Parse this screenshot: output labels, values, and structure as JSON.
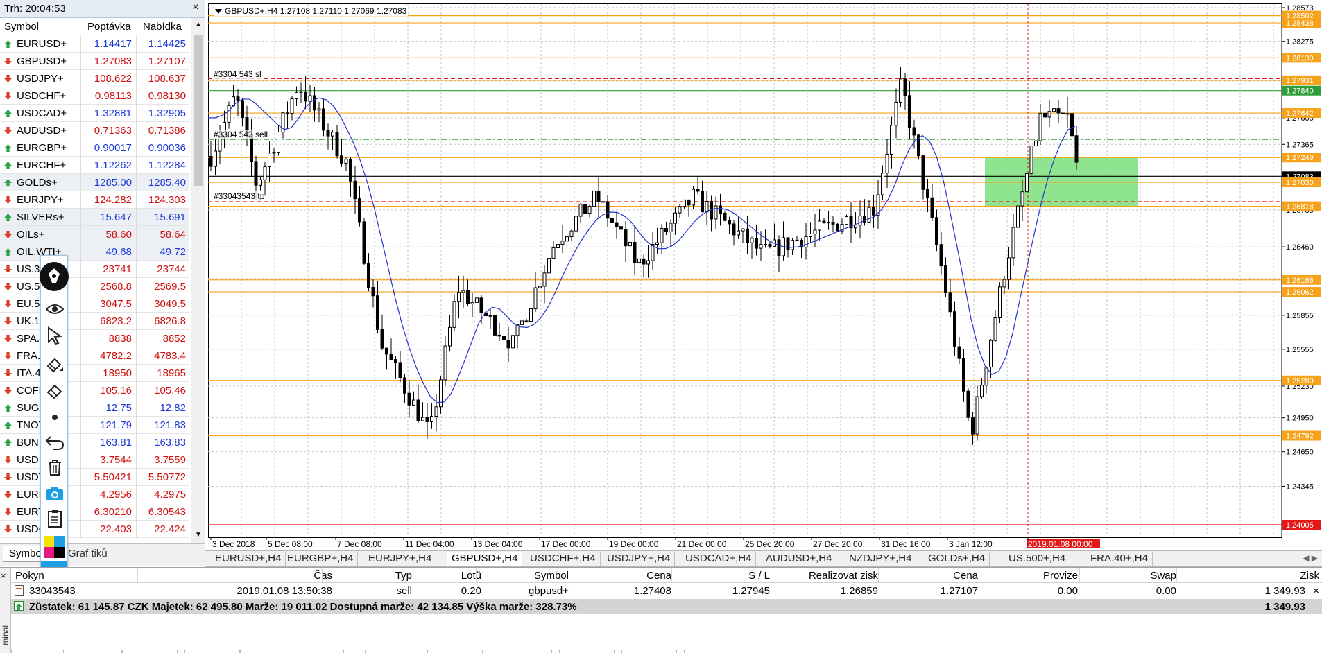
{
  "market_watch": {
    "title": "Trh: 20:04:53",
    "columns": {
      "symbol": "Symbol",
      "bid": "Poptávka",
      "ask": "Nabídka"
    },
    "rows": [
      {
        "symbol": "EURUSD+",
        "bid": "1.14417",
        "ask": "1.14425",
        "dir": "up",
        "color": "blue"
      },
      {
        "symbol": "GBPUSD+",
        "bid": "1.27083",
        "ask": "1.27107",
        "dir": "dn",
        "color": "red"
      },
      {
        "symbol": "USDJPY+",
        "bid": "108.622",
        "ask": "108.637",
        "dir": "dn",
        "color": "red"
      },
      {
        "symbol": "USDCHF+",
        "bid": "0.98113",
        "ask": "0.98130",
        "dir": "dn",
        "color": "red"
      },
      {
        "symbol": "USDCAD+",
        "bid": "1.32881",
        "ask": "1.32905",
        "dir": "up",
        "color": "blue"
      },
      {
        "symbol": "AUDUSD+",
        "bid": "0.71363",
        "ask": "0.71386",
        "dir": "dn",
        "color": "red"
      },
      {
        "symbol": "EURGBP+",
        "bid": "0.90017",
        "ask": "0.90036",
        "dir": "up",
        "color": "blue"
      },
      {
        "symbol": "EURCHF+",
        "bid": "1.12262",
        "ask": "1.12284",
        "dir": "up",
        "color": "blue"
      },
      {
        "symbol": "GOLDs+",
        "bid": "1285.00",
        "ask": "1285.40",
        "dir": "up",
        "color": "blue"
      },
      {
        "symbol": "EURJPY+",
        "bid": "124.282",
        "ask": "124.303",
        "dir": "dn",
        "color": "red"
      },
      {
        "symbol": "SILVERs+",
        "bid": "15.647",
        "ask": "15.691",
        "dir": "up",
        "color": "blue"
      },
      {
        "symbol": "OILs+",
        "bid": "58.60",
        "ask": "58.64",
        "dir": "dn",
        "color": "red"
      },
      {
        "symbol": "OIL.WTI+",
        "bid": "49.68",
        "ask": "49.72",
        "dir": "up",
        "color": "blue"
      },
      {
        "symbol": "US.30",
        "bid": "23741",
        "ask": "23744",
        "dir": "dn",
        "color": "red"
      },
      {
        "symbol": "US.50",
        "bid": "2568.8",
        "ask": "2569.5",
        "dir": "dn",
        "color": "red"
      },
      {
        "symbol": "EU.50",
        "bid": "3047.5",
        "ask": "3049.5",
        "dir": "dn",
        "color": "red"
      },
      {
        "symbol": "UK.10",
        "bid": "6823.2",
        "ask": "6826.8",
        "dir": "dn",
        "color": "red"
      },
      {
        "symbol": "SPA.3",
        "bid": "8838",
        "ask": "8852",
        "dir": "dn",
        "color": "red"
      },
      {
        "symbol": "FRA.4",
        "bid": "4782.2",
        "ask": "4783.4",
        "dir": "dn",
        "color": "red"
      },
      {
        "symbol": "ITA.4",
        "bid": "18950",
        "ask": "18965",
        "dir": "dn",
        "color": "red"
      },
      {
        "symbol": "COFF",
        "bid": "105.16",
        "ask": "105.46",
        "dir": "dn",
        "color": "red"
      },
      {
        "symbol": "SUGA",
        "bid": "12.75",
        "ask": "12.82",
        "dir": "up",
        "color": "blue"
      },
      {
        "symbol": "TNOT",
        "bid": "121.79",
        "ask": "121.83",
        "dir": "up",
        "color": "blue"
      },
      {
        "symbol": "BUN",
        "bid": "163.81",
        "ask": "163.83",
        "dir": "up",
        "color": "blue"
      },
      {
        "symbol": "USDI",
        "bid": "3.7544",
        "ask": "3.7559",
        "dir": "dn",
        "color": "red"
      },
      {
        "symbol": "USDT",
        "bid": "5.50421",
        "ask": "5.50772",
        "dir": "dn",
        "color": "red"
      },
      {
        "symbol": "EURP",
        "bid": "4.2956",
        "ask": "4.2975",
        "dir": "dn",
        "color": "red"
      },
      {
        "symbol": "EURT",
        "bid": "6.30210",
        "ask": "6.30543",
        "dir": "dn",
        "color": "red"
      },
      {
        "symbol": "USDC",
        "bid": "22.403",
        "ask": "22.424",
        "dir": "dn",
        "color": "red"
      }
    ],
    "tabs": {
      "symbols": "Symbo",
      "chart": "Graf tiků"
    }
  },
  "palette": {
    "tools": [
      "eye-icon",
      "cursor-icon",
      "pencil-icon",
      "eraser-icon",
      "dot-icon",
      "undo-icon",
      "trash-icon",
      "camera-icon",
      "clipboard-icon",
      "color-picker-icon"
    ],
    "colors": [
      "#f5e200",
      "#1d9fe6",
      "#e6197e",
      "#000000"
    ]
  },
  "chart": {
    "title": "GBPUSD+,H4  1.27108 1.27110 1.27069 1.27083",
    "order_labels": {
      "sl": "#3304 543 sl",
      "sell": "#3304 543 sell",
      "tp": "#33043543 tp"
    },
    "price_axis": [
      "1.28573",
      "1.28275",
      "1.27925",
      "1.27600",
      "1.27365",
      "1.27083",
      "1.26785",
      "1.26460",
      "1.26180",
      "1.25855",
      "1.25555",
      "1.25230",
      "1.24950",
      "1.24650",
      "1.24345",
      "1.24020"
    ],
    "price_levels": [
      {
        "price": "1.28502",
        "color": "#f7a21b"
      },
      {
        "price": "1.28438",
        "color": "#f7a21b"
      },
      {
        "price": "1.28130",
        "color": "#f7a21b"
      },
      {
        "price": "1.27931",
        "color": "#f7a21b"
      },
      {
        "price": "1.27840",
        "color": "#2e9e3a"
      },
      {
        "price": "1.27642",
        "color": "#f7a21b"
      },
      {
        "price": "1.27249",
        "color": "#f7a21b"
      },
      {
        "price": "1.27083",
        "color": "#000000"
      },
      {
        "price": "1.27030",
        "color": "#f7a21b"
      },
      {
        "price": "1.26818",
        "color": "#f7a21b"
      },
      {
        "price": "1.26168",
        "color": "#f7a21b"
      },
      {
        "price": "1.26062",
        "color": "#f7a21b"
      },
      {
        "price": "1.25280",
        "color": "#f7a21b"
      },
      {
        "price": "1.24792",
        "color": "#f7a21b"
      },
      {
        "price": "1.24005",
        "color": "#e31818"
      }
    ],
    "time_axis": [
      "3 Dec 2018",
      "5 Dec 08:00",
      "7 Dec 08:00",
      "11 Dec 04:00",
      "13 Dec 04:00",
      "17 Dec 00:00",
      "19 Dec 00:00",
      "21 Dec 00:00",
      "25 Dec 20:00",
      "27 Dec 20:00",
      "31 Dec 16:00",
      "3 Jan 12:00",
      "2019.01.08 00:00"
    ],
    "tabs": [
      "EURUSD+,H4",
      "EURGBP+,H4",
      "EURJPY+,H4",
      "GBPUSD+,H4",
      "USDCHF+,H4",
      "USDJPY+,H4",
      "USDCAD+,H4",
      "AUDUSD+,H4",
      "NZDJPY+,H4",
      "GOLDs+,H4",
      "US.500+,H4",
      "FRA.40+,H4"
    ],
    "active_tab": "GBPUSD+,H4"
  },
  "terminal": {
    "side_label": "minál",
    "headers": [
      "Pokyn",
      "Čas",
      "Typ",
      "Lotů",
      "Symbol",
      "Cena",
      "S / L",
      "Realizovat zisk",
      "Cena",
      "Provize",
      "Swap",
      "Zisk"
    ],
    "order": {
      "id": "33043543",
      "time": "2019.01.08 13:50:38",
      "type": "sell",
      "lots": "0.20",
      "symbol": "gbpusd+",
      "price": "1.27408",
      "sl": "1.27945",
      "tp": "1.26859",
      "cur_price": "1.27107",
      "commission": "0.00",
      "swap": "0.00",
      "profit": "1 349.93"
    },
    "balance": "Zůstatek: 61 145.87 CZK  Majetek: 62 495.80  Marže: 19 011.02  Dostupná marže: 42 134.85  Výška marže: 328.73%",
    "balance_profit": "1 349.93"
  }
}
